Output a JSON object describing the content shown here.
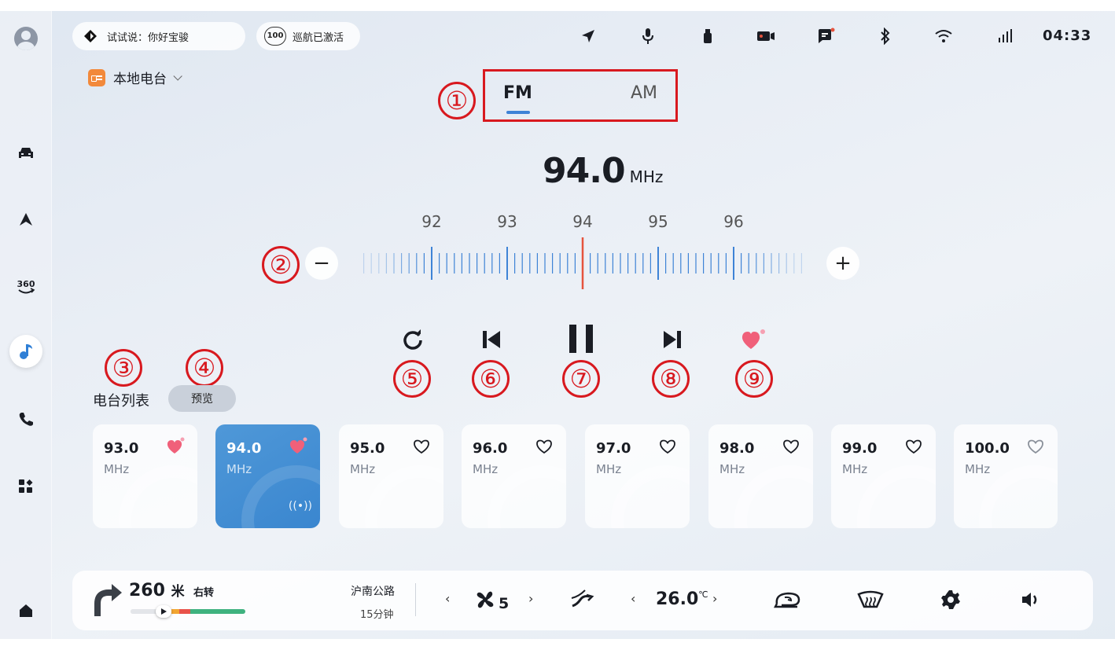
{
  "status_bar": {
    "voice_hint": "试试说：你好宝骏",
    "cruise_badge": "100",
    "cruise_badge_sub": "—/+",
    "cruise_label": "巡航已激活",
    "time": "04:33"
  },
  "source": {
    "label": "本地电台"
  },
  "band": {
    "tabs": [
      "FM",
      "AM"
    ],
    "selected": "FM"
  },
  "tuner": {
    "frequency": "94.0",
    "unit": "MHz",
    "scale_labels": [
      "92",
      "93",
      "94",
      "95",
      "96"
    ],
    "minus": "−",
    "plus": "+"
  },
  "annotations": [
    "①",
    "②",
    "③",
    "④",
    "⑤",
    "⑥",
    "⑦",
    "⑧",
    "⑨"
  ],
  "station_list": {
    "title": "电台列表",
    "preview": "预览",
    "stations": [
      {
        "freq": "93.0",
        "unit": "MHz",
        "favorite": true,
        "active": false
      },
      {
        "freq": "94.0",
        "unit": "MHz",
        "favorite": true,
        "active": true,
        "live": "((•))"
      },
      {
        "freq": "95.0",
        "unit": "MHz",
        "favorite": false,
        "active": false
      },
      {
        "freq": "96.0",
        "unit": "MHz",
        "favorite": false,
        "active": false
      },
      {
        "freq": "97.0",
        "unit": "MHz",
        "favorite": false,
        "active": false
      },
      {
        "freq": "98.0",
        "unit": "MHz",
        "favorite": false,
        "active": false
      },
      {
        "freq": "99.0",
        "unit": "MHz",
        "favorite": false,
        "active": false
      },
      {
        "freq": "100.0",
        "unit": "MHz",
        "favorite": false,
        "active": false
      }
    ]
  },
  "dock": {
    "nav_distance": "260",
    "nav_unit": "米",
    "nav_direction": "右转",
    "road": "沪南公路",
    "eta": "15分钟",
    "fan_level": "5",
    "temperature": "26.0",
    "temp_unit": "℃",
    "arrow_left": "‹",
    "arrow_right": "›"
  },
  "colors": {
    "accent": "#3e83d6",
    "annotation": "#d8191f",
    "tuner_needle": "#e5533d",
    "favorite": "#f0607a"
  }
}
